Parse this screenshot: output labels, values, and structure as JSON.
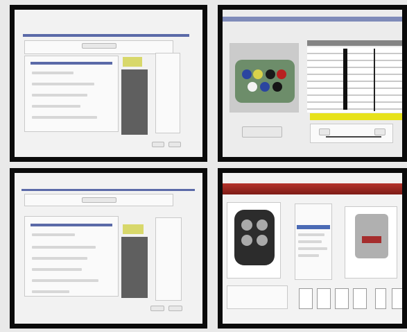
{
  "layout_name": "four-screens",
  "screens": [
    {
      "name": "screen-1",
      "header_label": "",
      "bottom_buttons": [
        "",
        ""
      ]
    },
    {
      "name": "screen-2",
      "bottom_left_button": "",
      "highlight_colors": [
        "#e7e21b"
      ]
    },
    {
      "name": "screen-3",
      "header_label": "",
      "bottom_buttons": [
        "",
        ""
      ]
    },
    {
      "name": "screen-4",
      "title_text": "",
      "accent_color": "#9b2a22"
    }
  ]
}
